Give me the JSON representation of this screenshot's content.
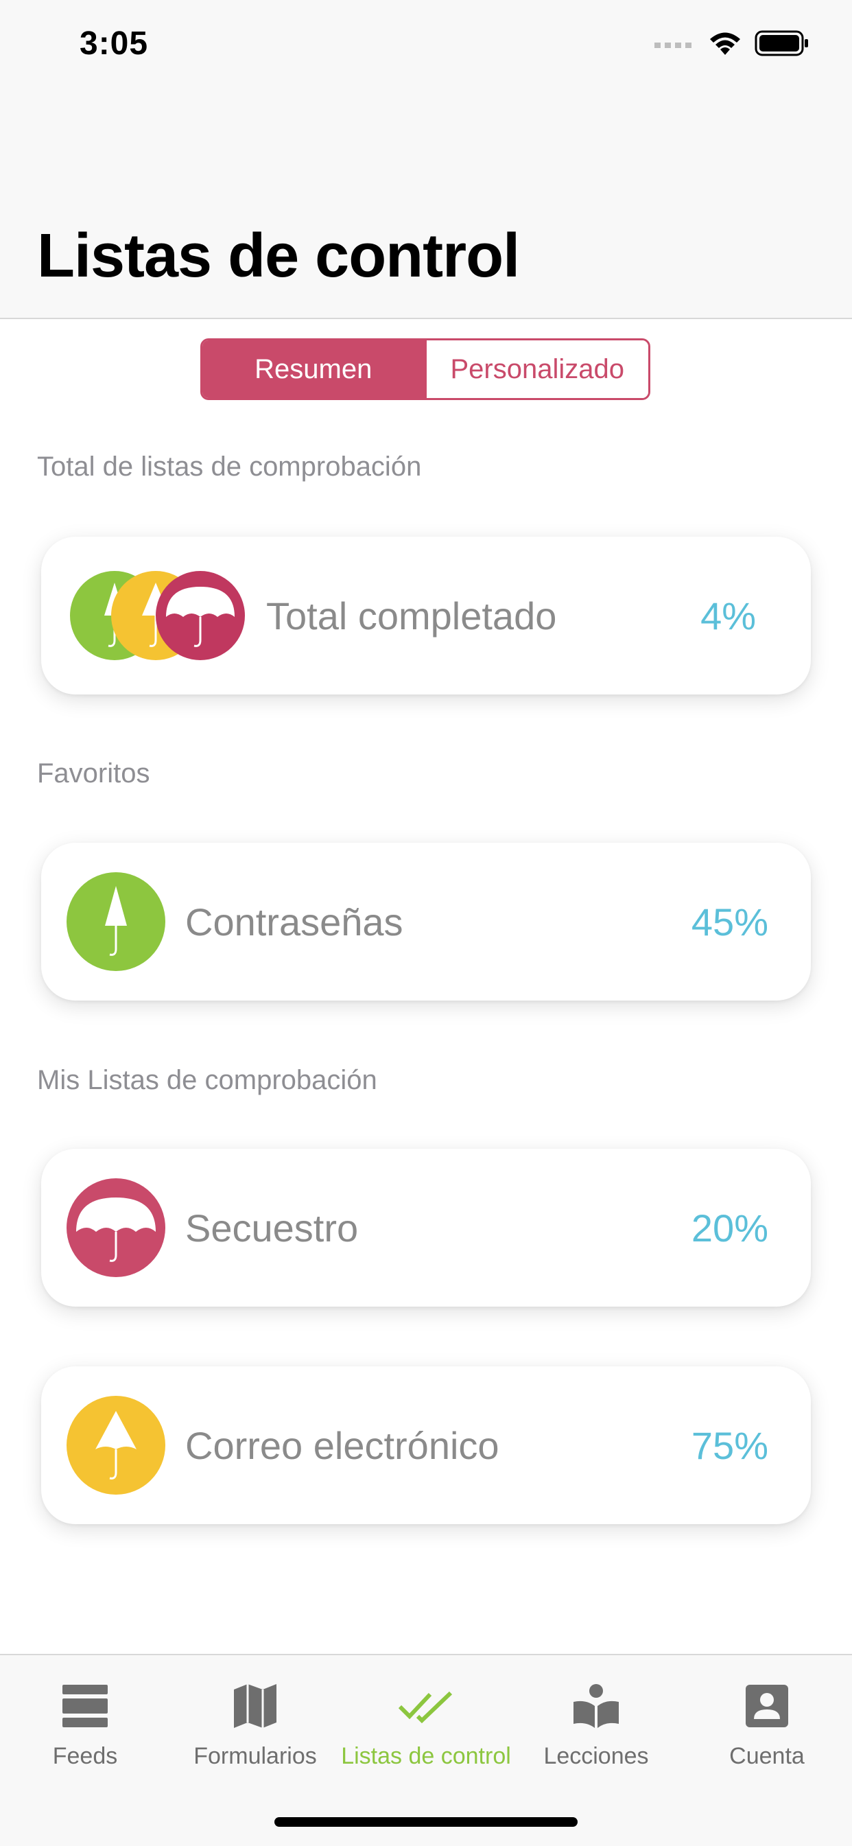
{
  "status_bar": {
    "time": "3:05"
  },
  "header": {
    "title": "Listas de control"
  },
  "segmented": {
    "tabs": [
      "Resumen",
      "Personalizado"
    ],
    "selected": "Resumen"
  },
  "sections": {
    "total": "Total de listas de comprobación",
    "favorites": "Favoritos",
    "mine": "Mis Listas de comprobación"
  },
  "cards": {
    "total": {
      "label": "Total completado",
      "value": "4%"
    },
    "passwords": {
      "label": "Contraseñas",
      "value": "45%",
      "icon": "umbrella-closed-icon",
      "color": "#8dc63f"
    },
    "kidnapping": {
      "label": "Secuestro",
      "value": "20%",
      "icon": "umbrella-open-icon",
      "color": "#c94a6a"
    },
    "email": {
      "label": "Correo electrónico",
      "value": "75%",
      "icon": "umbrella-half-icon",
      "color": "#f5c332"
    }
  },
  "tabbar": {
    "items": [
      {
        "label": "Feeds",
        "icon": "feeds-icon"
      },
      {
        "label": "Formularios",
        "icon": "map-icon"
      },
      {
        "label": "Listas de control",
        "icon": "double-check-icon",
        "active": true
      },
      {
        "label": "Lecciones",
        "icon": "reader-icon"
      },
      {
        "label": "Cuenta",
        "icon": "account-icon"
      }
    ]
  },
  "colors": {
    "accent": "#c94a6a",
    "value": "#5bbfd9",
    "active_tab": "#8cc63f",
    "green": "#8dc63f",
    "yellow": "#f5c332",
    "pink": "#c94a6a"
  }
}
